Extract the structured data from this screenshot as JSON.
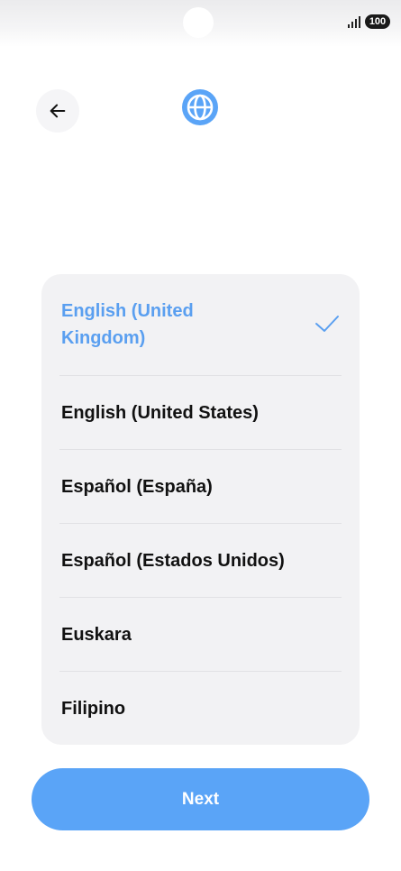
{
  "status_bar": {
    "battery": "100",
    "signal_icon": "signal-bars-icon"
  },
  "header": {
    "back_icon": "arrow-left-icon",
    "globe_icon": "globe-icon",
    "accent_color": "#5aa4f7"
  },
  "languages": {
    "items": [
      {
        "label": "English (United Kingdom)",
        "selected": true
      },
      {
        "label": "English (United States)",
        "selected": false
      },
      {
        "label": "Español (España)",
        "selected": false
      },
      {
        "label": "Español (Estados Unidos)",
        "selected": false
      },
      {
        "label": "Euskara",
        "selected": false
      },
      {
        "label": "Filipino",
        "selected": false
      }
    ],
    "selected_color": "#5a9ff0",
    "check_icon": "checkmark-icon"
  },
  "footer": {
    "next_label": "Next"
  }
}
